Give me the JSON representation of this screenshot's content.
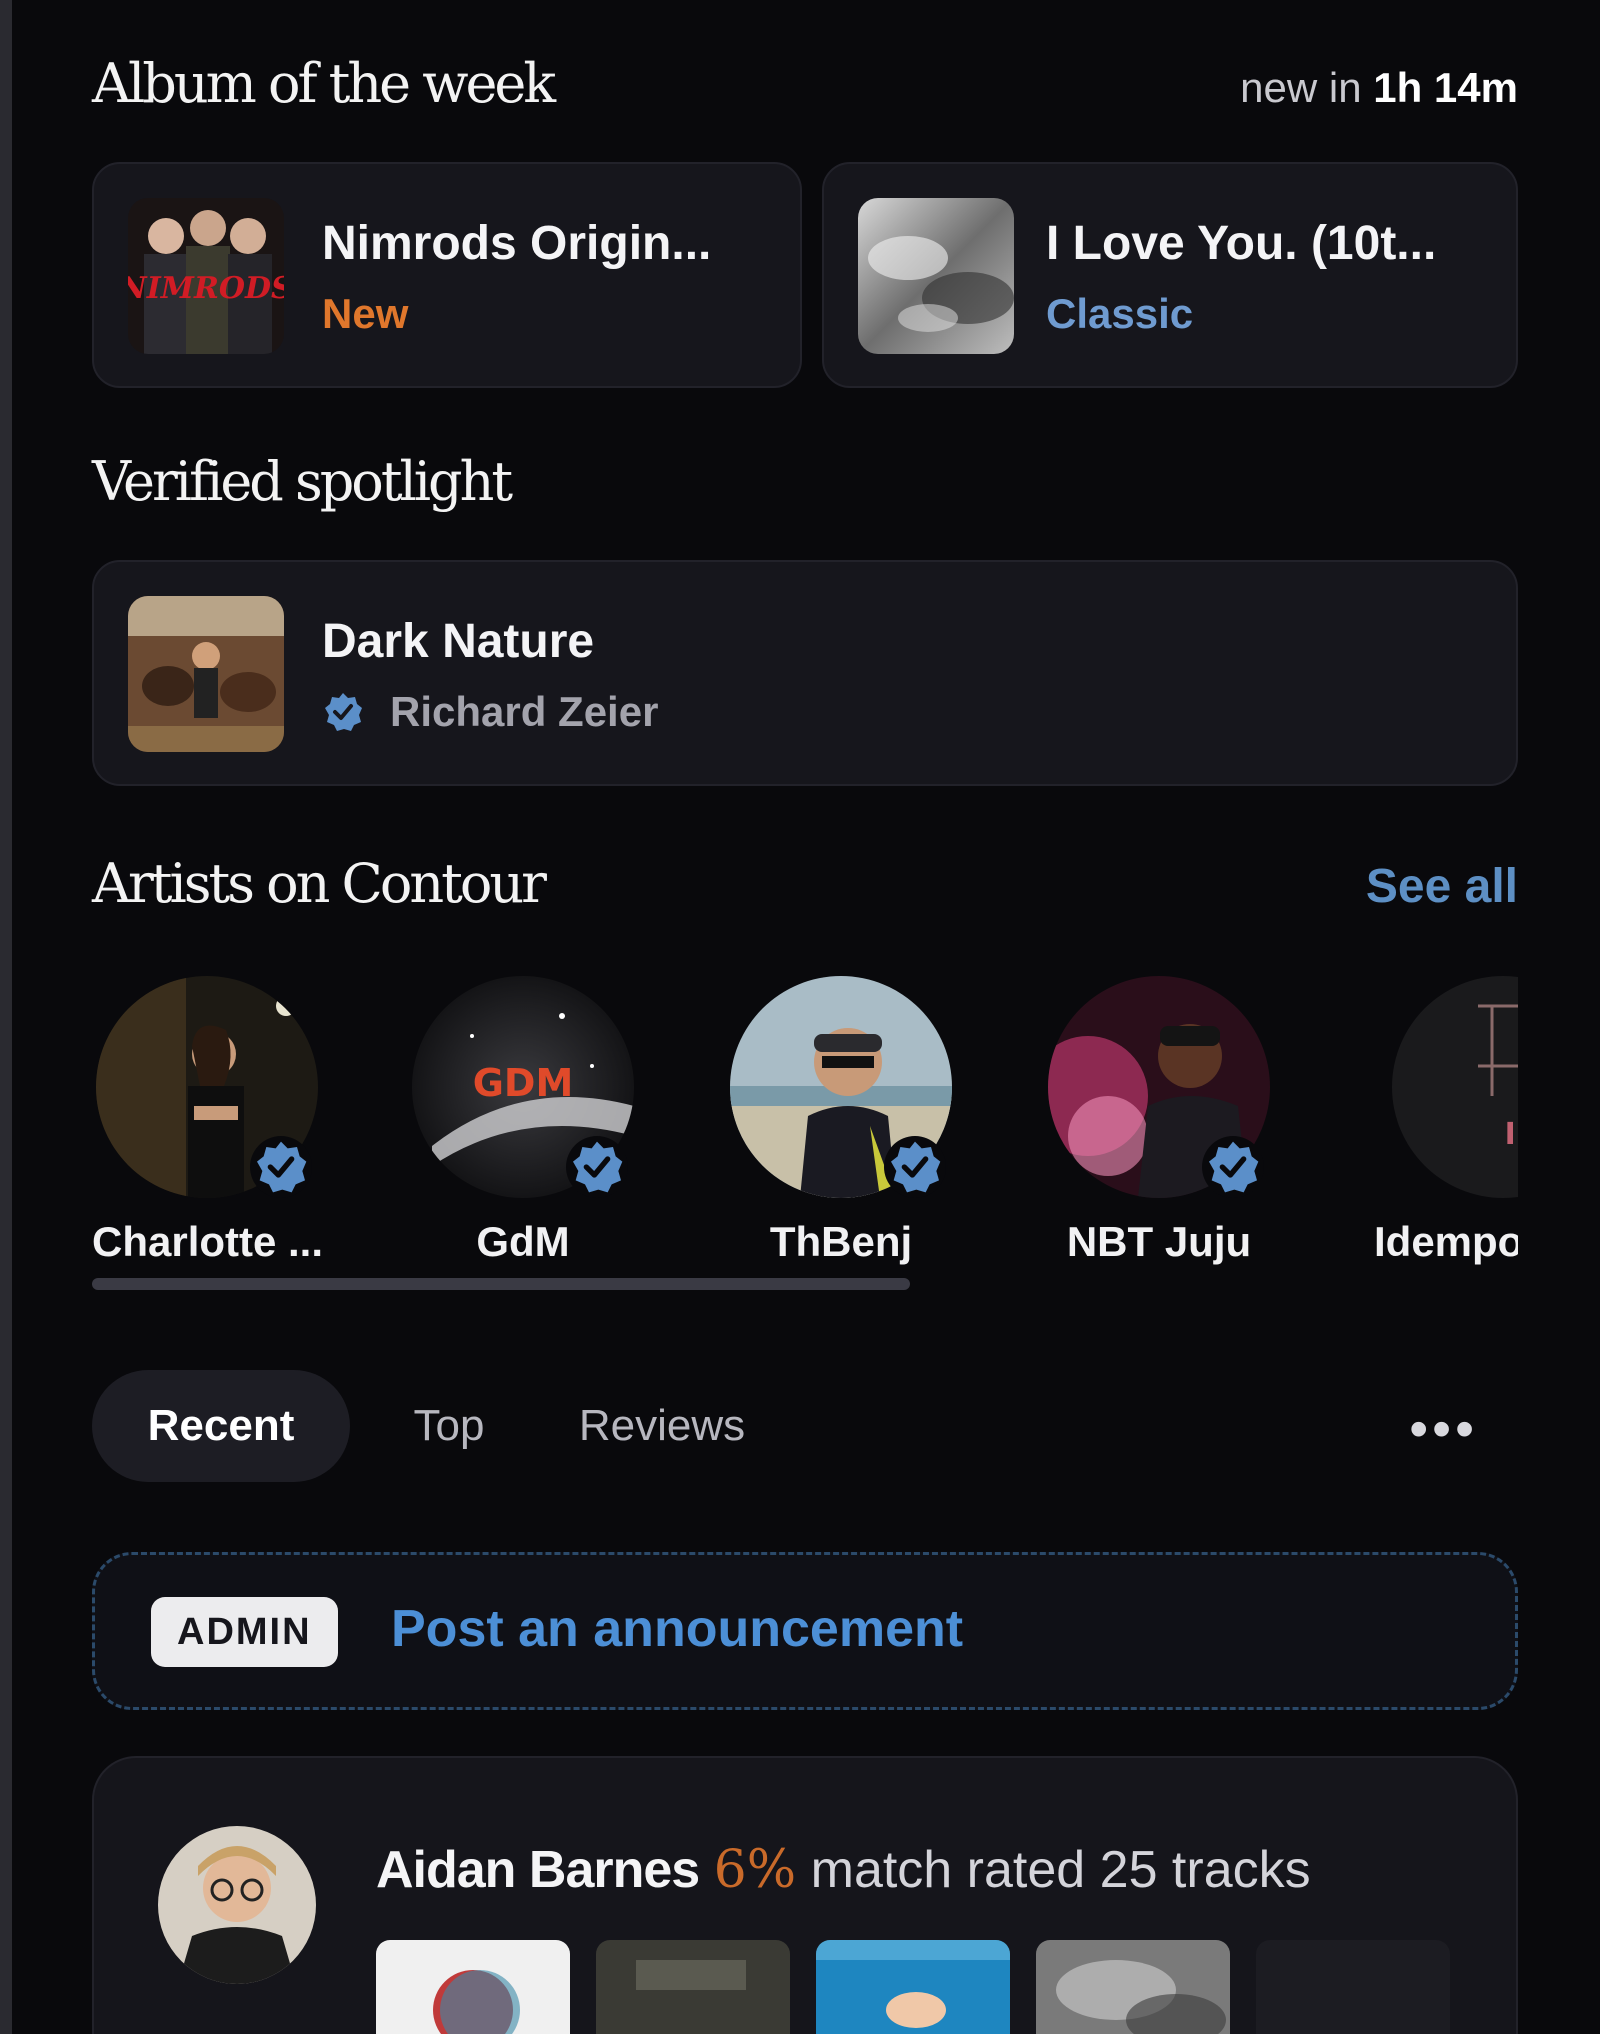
{
  "album_of_week": {
    "title": "Album of the week",
    "countdown_prefix": "new in",
    "countdown_value": "1h 14m",
    "cards": [
      {
        "title": "Nimrods Origin...",
        "tag": "New",
        "tag_color": "#e0772c",
        "cover_text": "NIMRODS"
      },
      {
        "title": "I Love You. (10t...",
        "tag": "Classic",
        "tag_color": "#6f9bd0"
      }
    ]
  },
  "spotlight": {
    "title": "Verified spotlight",
    "album": "Dark Nature",
    "artist": "Richard Zeier"
  },
  "artists": {
    "title": "Artists on Contour",
    "see_all": "See all",
    "items": [
      {
        "name": "Charlotte ...",
        "verified": true
      },
      {
        "name": "GdM",
        "verified": true,
        "logo_text": "GDM"
      },
      {
        "name": "ThBenj",
        "verified": true
      },
      {
        "name": "NBT Juju",
        "verified": true
      },
      {
        "name": "Idempo",
        "verified": false,
        "logo_text": "I AM"
      }
    ]
  },
  "tabs": [
    {
      "label": "Recent",
      "active": true
    },
    {
      "label": "Top",
      "active": false
    },
    {
      "label": "Reviews",
      "active": false
    }
  ],
  "more_label": "•••",
  "announcement": {
    "badge": "ADMIN",
    "text": "Post an announcement"
  },
  "feed": [
    {
      "user": "Aidan Barnes",
      "match": "6%",
      "rest": "match rated 25 tracks"
    }
  ],
  "colors": {
    "accent_blue": "#5d8fc4",
    "announce_blue": "#4c8fd6",
    "new_orange": "#e0772c",
    "verified_blue": "#5b8fc9"
  }
}
